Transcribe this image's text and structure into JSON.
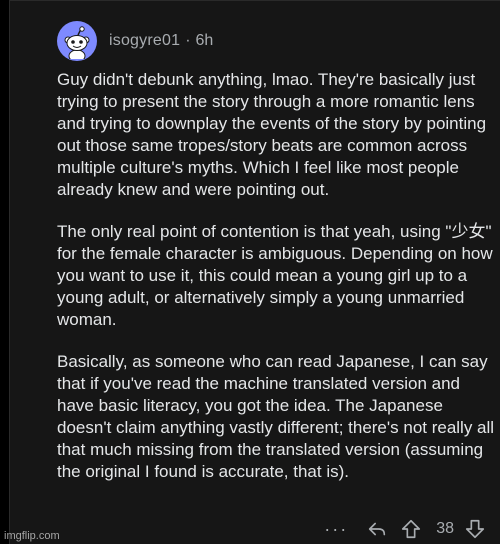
{
  "comment": {
    "username": "isogyre01",
    "separator": "·",
    "time": "6h",
    "paragraphs": [
      "Guy didn't debunk anything, lmao. They're basically just trying to present the story through a more romantic lens and trying to downplay the events of the story by pointing out those same tropes/story beats are common across multiple culture's myths. Which I feel like most people already knew and were pointing out.",
      "The only real point of contention is that yeah, using \"少女\" for the female character is ambiguous. Depending on how you want to use it, this could mean a young girl up to a young adult, or alternatively simply a young unmarried woman.",
      "Basically, as someone who can read Japanese, I can say that if you've read the machine translated version and have basic literacy, you got the idea. The Japanese doesn't claim anything vastly different; there's not really all that much missing from the translated version (assuming the original I found is accurate, that is)."
    ]
  },
  "actions": {
    "more_label": "···",
    "reply_icon": "reply-icon",
    "upvote_icon": "upvote-icon",
    "downvote_icon": "downvote-icon",
    "vote_count": "38"
  },
  "watermark": "imgflip.com",
  "colors": {
    "background": "#000000",
    "card": "#161616",
    "text": "#e4e6e8",
    "meta": "#a8acb0",
    "avatar": "#7e8aff"
  }
}
